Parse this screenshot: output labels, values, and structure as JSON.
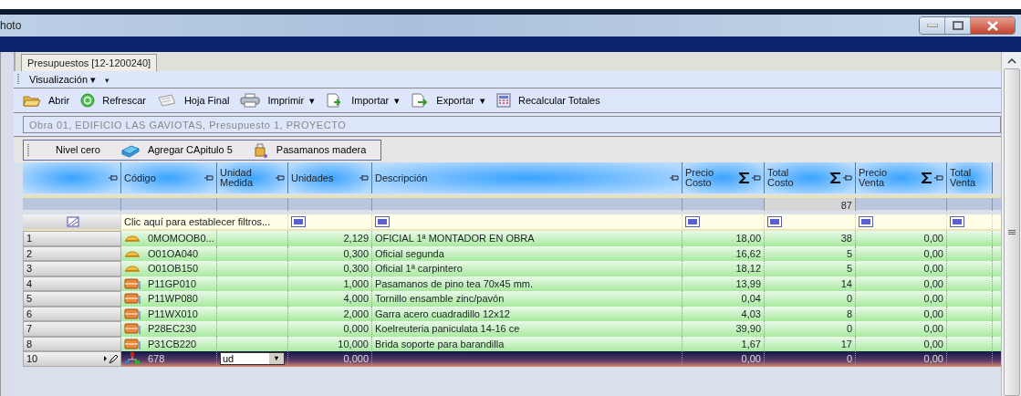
{
  "window": {
    "title": "hoto"
  },
  "tabs": [
    {
      "label": "Presupuestos [12-1200240]",
      "selected": true
    }
  ],
  "menu": {
    "label": "Visualización",
    "caret": "▾"
  },
  "toolbar": [
    {
      "kind": "folder",
      "label": "Abrir",
      "dropdown": false
    },
    {
      "kind": "refresh",
      "label": "Refrescar",
      "dropdown": false
    },
    {
      "kind": "sheet",
      "label": "Hoja Final",
      "dropdown": false
    },
    {
      "kind": "printer",
      "label": "Imprimir",
      "dropdown": true
    },
    {
      "kind": "import",
      "label": "Importar",
      "dropdown": true
    },
    {
      "kind": "export",
      "label": "Exportar",
      "dropdown": true
    },
    {
      "kind": "calculator",
      "label": "Recalcular Totales",
      "dropdown": false
    }
  ],
  "path_field": {
    "value": "Obra 01, EDIFICIO LAS GAVIOTAS, Presupuesto 1, PROYECTO"
  },
  "breadcrumb": [
    {
      "kind": "plain",
      "label": "Nivel cero"
    },
    {
      "kind": "chapter",
      "label": "Agregar CApitulo 5"
    },
    {
      "kind": "item",
      "label": "Pasamanos madera"
    }
  ],
  "table": {
    "columns": [
      {
        "sum": false
      },
      {
        "label": "Código",
        "sum": false
      },
      {
        "label": "Unidad Medida",
        "sum": false
      },
      {
        "label": "Unidades",
        "sum": false
      },
      {
        "label": "Descripción",
        "sum": false
      },
      {
        "label": "Precio Costo",
        "sum": true
      },
      {
        "label": "Total Costo",
        "sum": true
      },
      {
        "label": "Precio Venta",
        "sum": true
      },
      {
        "label": "Total Venta",
        "sum": false
      }
    ],
    "summary": {
      "total_costo": "87"
    },
    "filter_text": "Clic aquí para establecer filtros...",
    "rows": [
      {
        "num": "1",
        "kind": "labor",
        "code": "0MOMOOB0...",
        "units": "2,129",
        "desc": "OFICIAL 1ª MONTADOR EN OBRA",
        "precio_costo": "18,00",
        "total_costo": "38",
        "precio_venta": "0,00",
        "selected": false
      },
      {
        "num": "2",
        "kind": "labor",
        "code": "O01OA040",
        "units": "0,300",
        "desc": "Oficial segunda",
        "precio_costo": "16,62",
        "total_costo": "5",
        "precio_venta": "0,00",
        "selected": false
      },
      {
        "num": "3",
        "kind": "labor",
        "code": "O01OB150",
        "units": "0,300",
        "desc": "Oficial 1ª carpintero",
        "precio_costo": "18,12",
        "total_costo": "5",
        "precio_venta": "0,00",
        "selected": false
      },
      {
        "num": "4",
        "kind": "material",
        "code": "P11GP010",
        "units": "1,000",
        "desc": "Pasamanos de pino tea 70x45 mm.",
        "precio_costo": "13,99",
        "total_costo": "14",
        "precio_venta": "0,00",
        "selected": false
      },
      {
        "num": "5",
        "kind": "material",
        "code": "P11WP080",
        "units": "4,000",
        "desc": "Tornillo ensamble zinc/pavón",
        "precio_costo": "0,04",
        "total_costo": "0",
        "precio_venta": "0,00",
        "selected": false
      },
      {
        "num": "6",
        "kind": "material",
        "code": "P11WX010",
        "units": "2,000",
        "desc": "Garra acero cuadradillo 12x12",
        "precio_costo": "4,03",
        "total_costo": "8",
        "precio_venta": "0,00",
        "selected": false
      },
      {
        "num": "7",
        "kind": "material",
        "code": "P28EC230",
        "units": "0,000",
        "desc": "Koelreuteria paniculata 14-16 ce",
        "precio_costo": "39,90",
        "total_costo": "0",
        "precio_venta": "0,00",
        "selected": false
      },
      {
        "num": "8",
        "kind": "material",
        "code": "P31CB220",
        "units": "10,000",
        "desc": "Brida soporte para barandilla",
        "precio_costo": "1,67",
        "total_costo": "17",
        "precio_venta": "0,00",
        "selected": false
      },
      {
        "num": "10",
        "kind": "new",
        "code": "678",
        "unit": "ud",
        "units": "0,000",
        "precio_costo": "0,00",
        "total_costo": "0",
        "precio_venta": "0,00",
        "selected": true
      }
    ]
  }
}
